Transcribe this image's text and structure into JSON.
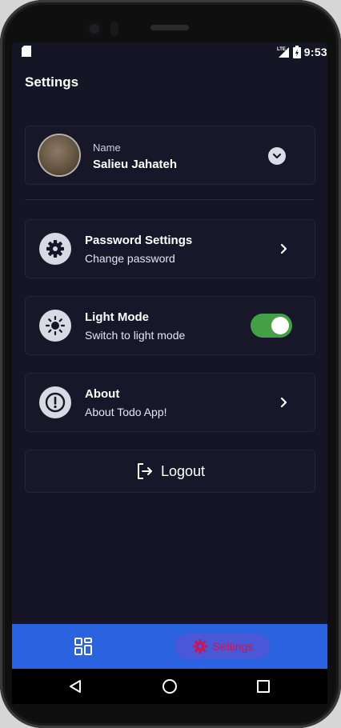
{
  "status": {
    "network": "LTE",
    "time": "9:53"
  },
  "page": {
    "title": "Settings"
  },
  "profile": {
    "label": "Name",
    "name": "Salieu Jahateh"
  },
  "options": [
    {
      "title": "Password Settings",
      "subtitle": "Change password",
      "icon": "gear-icon",
      "trailing": "chevron-right-icon"
    },
    {
      "title": "Light Mode",
      "subtitle": "Switch to light mode",
      "icon": "sun-icon",
      "trailing": "toggle",
      "toggle_on": true
    },
    {
      "title": "About",
      "subtitle": "About Todo App!",
      "icon": "info-icon",
      "trailing": "chevron-right-icon"
    }
  ],
  "logout": {
    "label": "Logout",
    "icon": "logout-icon"
  },
  "bottom_nav": {
    "items": [
      {
        "icon": "dashboard-icon",
        "label": ""
      },
      {
        "icon": "gear-icon",
        "label": "Settings",
        "active": true
      }
    ]
  },
  "colors": {
    "background": "#151526",
    "card_border": "#26263a",
    "bottom_nav": "#2a62e0",
    "active_pill": "#4a57d6",
    "active_accent": "#c2185b",
    "toggle_on": "#43a047"
  }
}
